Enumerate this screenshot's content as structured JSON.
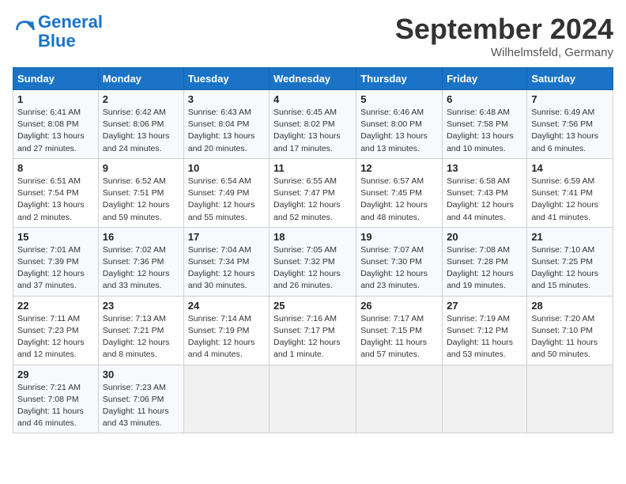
{
  "logo": {
    "line1": "General",
    "line2": "Blue"
  },
  "title": "September 2024",
  "location": "Wilhelmsfeld, Germany",
  "days_header": [
    "Sunday",
    "Monday",
    "Tuesday",
    "Wednesday",
    "Thursday",
    "Friday",
    "Saturday"
  ],
  "weeks": [
    [
      {
        "day": "1",
        "detail": "Sunrise: 6:41 AM\nSunset: 8:08 PM\nDaylight: 13 hours\nand 27 minutes."
      },
      {
        "day": "2",
        "detail": "Sunrise: 6:42 AM\nSunset: 8:06 PM\nDaylight: 13 hours\nand 24 minutes."
      },
      {
        "day": "3",
        "detail": "Sunrise: 6:43 AM\nSunset: 8:04 PM\nDaylight: 13 hours\nand 20 minutes."
      },
      {
        "day": "4",
        "detail": "Sunrise: 6:45 AM\nSunset: 8:02 PM\nDaylight: 13 hours\nand 17 minutes."
      },
      {
        "day": "5",
        "detail": "Sunrise: 6:46 AM\nSunset: 8:00 PM\nDaylight: 13 hours\nand 13 minutes."
      },
      {
        "day": "6",
        "detail": "Sunrise: 6:48 AM\nSunset: 7:58 PM\nDaylight: 13 hours\nand 10 minutes."
      },
      {
        "day": "7",
        "detail": "Sunrise: 6:49 AM\nSunset: 7:56 PM\nDaylight: 13 hours\nand 6 minutes."
      }
    ],
    [
      {
        "day": "8",
        "detail": "Sunrise: 6:51 AM\nSunset: 7:54 PM\nDaylight: 13 hours\nand 2 minutes."
      },
      {
        "day": "9",
        "detail": "Sunrise: 6:52 AM\nSunset: 7:51 PM\nDaylight: 12 hours\nand 59 minutes."
      },
      {
        "day": "10",
        "detail": "Sunrise: 6:54 AM\nSunset: 7:49 PM\nDaylight: 12 hours\nand 55 minutes."
      },
      {
        "day": "11",
        "detail": "Sunrise: 6:55 AM\nSunset: 7:47 PM\nDaylight: 12 hours\nand 52 minutes."
      },
      {
        "day": "12",
        "detail": "Sunrise: 6:57 AM\nSunset: 7:45 PM\nDaylight: 12 hours\nand 48 minutes."
      },
      {
        "day": "13",
        "detail": "Sunrise: 6:58 AM\nSunset: 7:43 PM\nDaylight: 12 hours\nand 44 minutes."
      },
      {
        "day": "14",
        "detail": "Sunrise: 6:59 AM\nSunset: 7:41 PM\nDaylight: 12 hours\nand 41 minutes."
      }
    ],
    [
      {
        "day": "15",
        "detail": "Sunrise: 7:01 AM\nSunset: 7:39 PM\nDaylight: 12 hours\nand 37 minutes."
      },
      {
        "day": "16",
        "detail": "Sunrise: 7:02 AM\nSunset: 7:36 PM\nDaylight: 12 hours\nand 33 minutes."
      },
      {
        "day": "17",
        "detail": "Sunrise: 7:04 AM\nSunset: 7:34 PM\nDaylight: 12 hours\nand 30 minutes."
      },
      {
        "day": "18",
        "detail": "Sunrise: 7:05 AM\nSunset: 7:32 PM\nDaylight: 12 hours\nand 26 minutes."
      },
      {
        "day": "19",
        "detail": "Sunrise: 7:07 AM\nSunset: 7:30 PM\nDaylight: 12 hours\nand 23 minutes."
      },
      {
        "day": "20",
        "detail": "Sunrise: 7:08 AM\nSunset: 7:28 PM\nDaylight: 12 hours\nand 19 minutes."
      },
      {
        "day": "21",
        "detail": "Sunrise: 7:10 AM\nSunset: 7:25 PM\nDaylight: 12 hours\nand 15 minutes."
      }
    ],
    [
      {
        "day": "22",
        "detail": "Sunrise: 7:11 AM\nSunset: 7:23 PM\nDaylight: 12 hours\nand 12 minutes."
      },
      {
        "day": "23",
        "detail": "Sunrise: 7:13 AM\nSunset: 7:21 PM\nDaylight: 12 hours\nand 8 minutes."
      },
      {
        "day": "24",
        "detail": "Sunrise: 7:14 AM\nSunset: 7:19 PM\nDaylight: 12 hours\nand 4 minutes."
      },
      {
        "day": "25",
        "detail": "Sunrise: 7:16 AM\nSunset: 7:17 PM\nDaylight: 12 hours\nand 1 minute."
      },
      {
        "day": "26",
        "detail": "Sunrise: 7:17 AM\nSunset: 7:15 PM\nDaylight: 11 hours\nand 57 minutes."
      },
      {
        "day": "27",
        "detail": "Sunrise: 7:19 AM\nSunset: 7:12 PM\nDaylight: 11 hours\nand 53 minutes."
      },
      {
        "day": "28",
        "detail": "Sunrise: 7:20 AM\nSunset: 7:10 PM\nDaylight: 11 hours\nand 50 minutes."
      }
    ],
    [
      {
        "day": "29",
        "detail": "Sunrise: 7:21 AM\nSunset: 7:08 PM\nDaylight: 11 hours\nand 46 minutes."
      },
      {
        "day": "30",
        "detail": "Sunrise: 7:23 AM\nSunset: 7:06 PM\nDaylight: 11 hours\nand 43 minutes."
      },
      {
        "day": "",
        "detail": ""
      },
      {
        "day": "",
        "detail": ""
      },
      {
        "day": "",
        "detail": ""
      },
      {
        "day": "",
        "detail": ""
      },
      {
        "day": "",
        "detail": ""
      }
    ]
  ]
}
